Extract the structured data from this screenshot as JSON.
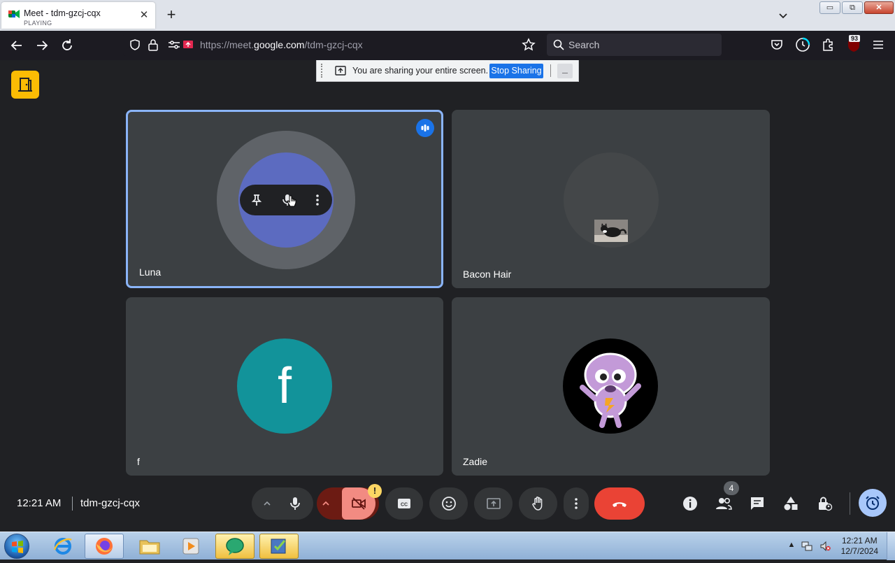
{
  "browser": {
    "tab": {
      "title": "Meet - tdm-gzcj-cqx",
      "status": "PLAYING",
      "close": "✕"
    },
    "new_tab": "+",
    "window_buttons": {
      "minimize": "▭",
      "restore": "⧉",
      "close": "✕"
    },
    "url": {
      "prefix": "https://meet.",
      "domain": "google.com",
      "path": "/tdm-gzcj-cqx"
    },
    "search_placeholder": "Search",
    "extension_badge": "93"
  },
  "share_banner": {
    "text": "You are sharing your entire screen.",
    "stop_label": "Stop Sharing",
    "hide_label": "_"
  },
  "participants": [
    {
      "name": "Luna",
      "avatar_color": "#5c6bc0",
      "speaking": true
    },
    {
      "name": "Bacon Hair",
      "avatar_color": "#444749"
    },
    {
      "name": "f",
      "avatar_letter": "f",
      "avatar_color": "#12939a"
    },
    {
      "name": "Zadie",
      "avatar_color": "#000000"
    }
  ],
  "controls": {
    "time": "12:21 AM",
    "meeting_code": "tdm-gzcj-cqx",
    "camera_warning": "!",
    "people_count": "4"
  },
  "taskbar": {
    "clock_time": "12:21 AM",
    "clock_date": "12/7/2024"
  },
  "colors": {
    "meet_bg": "#202124",
    "tile_bg": "#3c4043",
    "accent_blue": "#1a73e8",
    "end_call_red": "#ea4335",
    "camera_off_red": "#f28b82",
    "companion_yellow": "#fbbc04"
  }
}
